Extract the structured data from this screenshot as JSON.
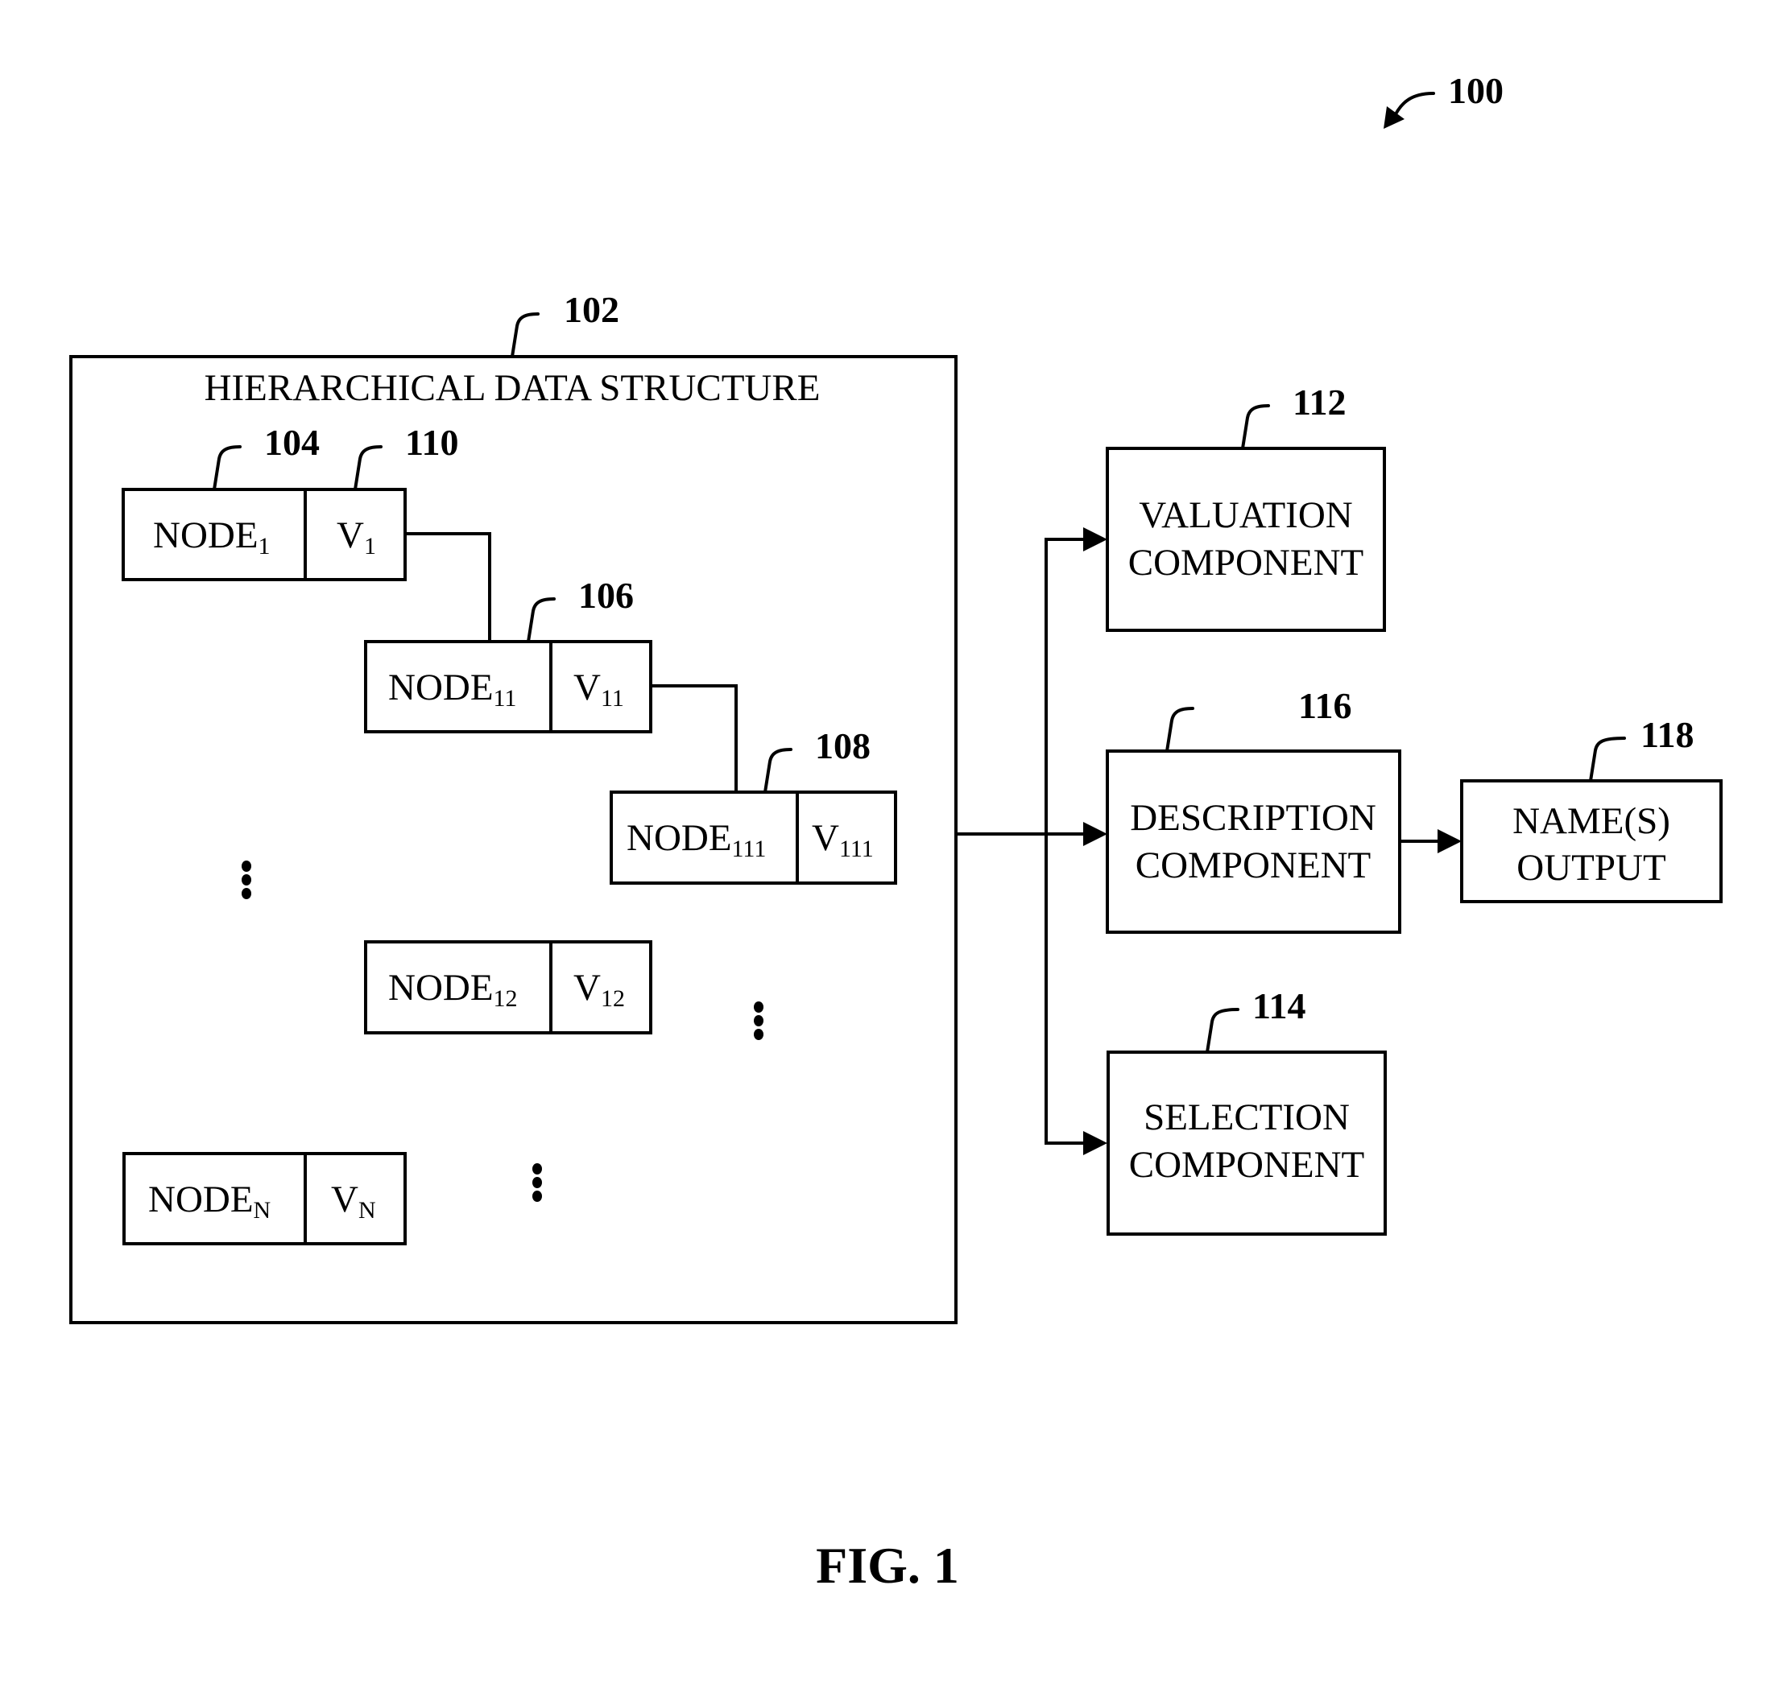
{
  "figure": {
    "label": "FIG. 1",
    "reference": "100"
  },
  "hierarchical_structure": {
    "title": "HIERARCHICAL DATA STRUCTURE",
    "reference": "102",
    "nodes": [
      {
        "id": "node1",
        "name": "NODE",
        "name_sub": "1",
        "value": "V",
        "value_sub": "1",
        "node_ref": "104",
        "value_ref": "110"
      },
      {
        "id": "node11",
        "name": "NODE",
        "name_sub": "11",
        "value": "V",
        "value_sub": "11",
        "node_ref": "106"
      },
      {
        "id": "node111",
        "name": "NODE",
        "name_sub": "111",
        "value": "V",
        "value_sub": "111",
        "node_ref": "108"
      },
      {
        "id": "node12",
        "name": "NODE",
        "name_sub": "12",
        "value": "V",
        "value_sub": "12"
      },
      {
        "id": "nodeN",
        "name": "NODE",
        "name_sub": "N",
        "value": "V",
        "value_sub": "N"
      }
    ],
    "ellipsis": "⋮"
  },
  "components": {
    "valuation": {
      "line1": "VALUATION",
      "line2": "COMPONENT",
      "reference": "112"
    },
    "description": {
      "line1": "DESCRIPTION",
      "line2": "COMPONENT",
      "reference": "116"
    },
    "selection": {
      "line1": "SELECTION",
      "line2": "COMPONENT",
      "reference": "114"
    },
    "names_output": {
      "line1": "NAME(S)",
      "line2": "OUTPUT",
      "reference": "118"
    }
  }
}
